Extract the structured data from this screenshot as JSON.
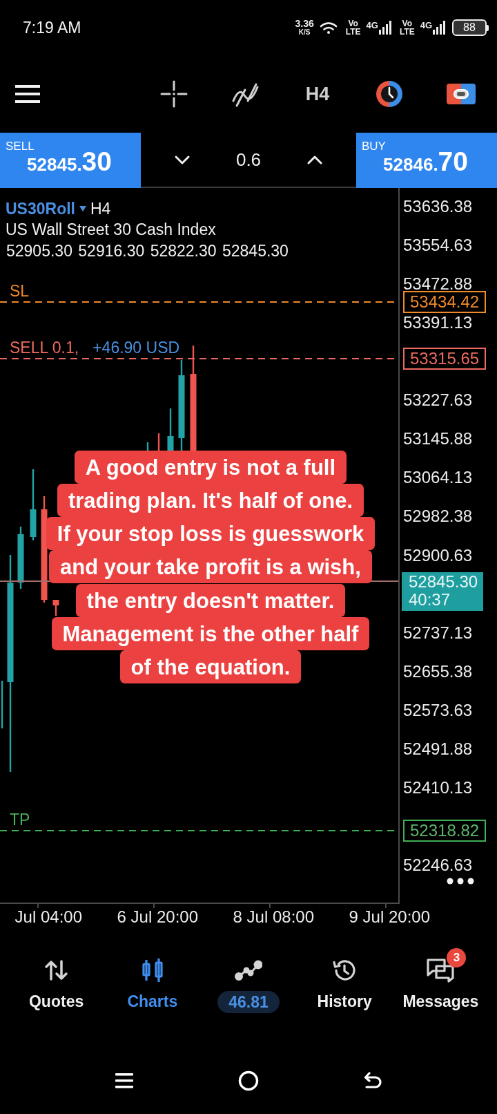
{
  "status_bar": {
    "time": "7:19 AM",
    "net_speed": "3.36",
    "net_unit": "K/S",
    "sims": [
      {
        "volte": "Vo",
        "volte_sub": "LTE",
        "network": "4G"
      },
      {
        "volte": "Vo",
        "volte_sub": "LTE",
        "network": "4G"
      }
    ],
    "battery": "88"
  },
  "toolbar": {
    "timeframe": "H4"
  },
  "trade_bar": {
    "sell": {
      "label": "SELL",
      "price": "52845.30"
    },
    "volume": "0.6",
    "buy": {
      "label": "BUY",
      "price": "52846.70"
    }
  },
  "chart": {
    "symbol": "US30Roll",
    "timeframe": "H4",
    "description": "US Wall Street 30 Cash Index",
    "ohlc": "52905.30 52916.30 52822.30 52845.30",
    "price_ticks": [
      "53636.38",
      "53554.63",
      "53472.88",
      "53391.13",
      "53227.63",
      "53145.88",
      "53064.13",
      "52982.38",
      "52900.63",
      "52737.13",
      "52655.38",
      "52573.63",
      "52491.88",
      "52410.13",
      "52246.63"
    ],
    "levels": [
      {
        "kind": "sl",
        "label": "SL",
        "price": "53434.42"
      },
      {
        "kind": "position",
        "label": "SELL 0.1,",
        "profit": "+46.90 USD",
        "price": "53315.65"
      },
      {
        "kind": "current",
        "price": "52845.30",
        "countdown": "40:37"
      },
      {
        "kind": "tp",
        "label": "TP",
        "price": "52318.82"
      }
    ],
    "time_labels": [
      "Jul 04:00",
      "6 Jul 20:00",
      "8 Jul 08:00",
      "9 Jul 20:00"
    ]
  },
  "caption": {
    "lines": [
      "A good entry is not a full",
      "trading plan. It's half of one.",
      "If your stop loss is guesswork",
      "and your take profit is a wish,",
      "the entry doesn't matter.",
      "Management is the other half",
      "of the equation."
    ]
  },
  "bottom_nav": {
    "items": [
      {
        "kind": "quotes",
        "label": "Quotes",
        "selected": false
      },
      {
        "kind": "charts",
        "label": "Charts",
        "selected": true
      },
      {
        "kind": "trade",
        "label": "46.81",
        "selected": false
      },
      {
        "kind": "history",
        "label": "History",
        "selected": false
      },
      {
        "kind": "messages",
        "label": "Messages",
        "selected": false,
        "badge": "3"
      }
    ]
  }
}
